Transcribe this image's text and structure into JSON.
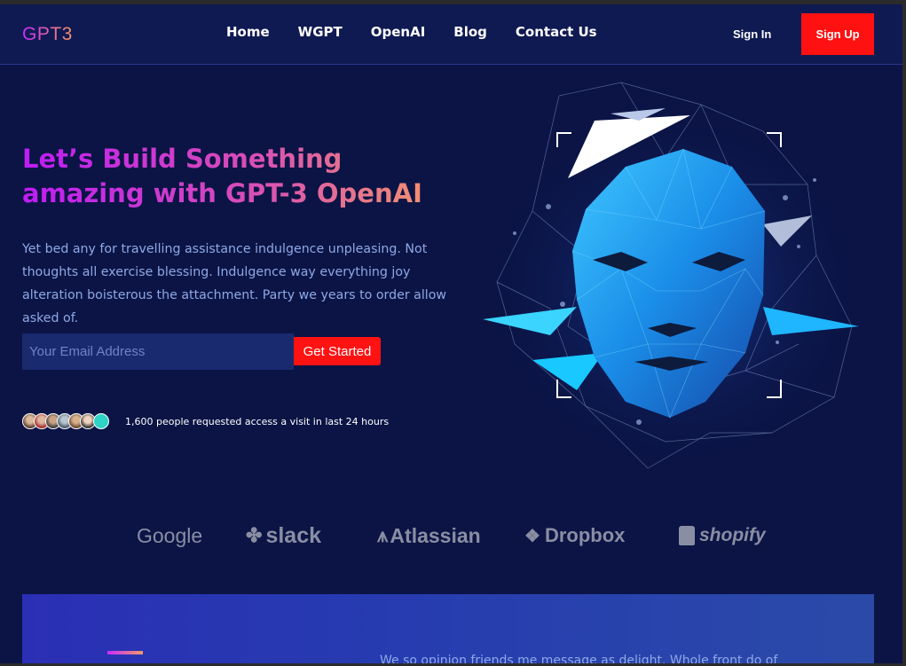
{
  "nav": {
    "logo": "GPT3",
    "links": [
      "Home",
      "WGPT",
      "OpenAI",
      "Blog",
      "Contact Us"
    ],
    "sign_in": "Sign In",
    "sign_up": "Sign Up"
  },
  "hero": {
    "title": "Let’s Build Something amazing with GPT-3 OpenAI",
    "description": "Yet bed any for travelling assistance indulgence unpleasing. Not thoughts all exercise blessing. Indulgence way everything joy alteration boisterous the attachment. Party we years to order allow asked of.",
    "email_placeholder": "Your Email Address",
    "cta_button": "Get Started",
    "access_text": "1,600 people requested access a visit in last 24 hours",
    "image_alt": "ai-face-illustration"
  },
  "brands": [
    "Google",
    "slack",
    "Atlassian",
    "Dropbox",
    "shopify"
  ],
  "possibility": {
    "text": "We so opinion friends me message as delight. Whole front do of"
  },
  "colors": {
    "background": "#0b1445",
    "accent_red": "#ff1111",
    "gradient_start": "#c82bff",
    "gradient_end": "#f49867",
    "body_text": "#8fa8e6"
  }
}
